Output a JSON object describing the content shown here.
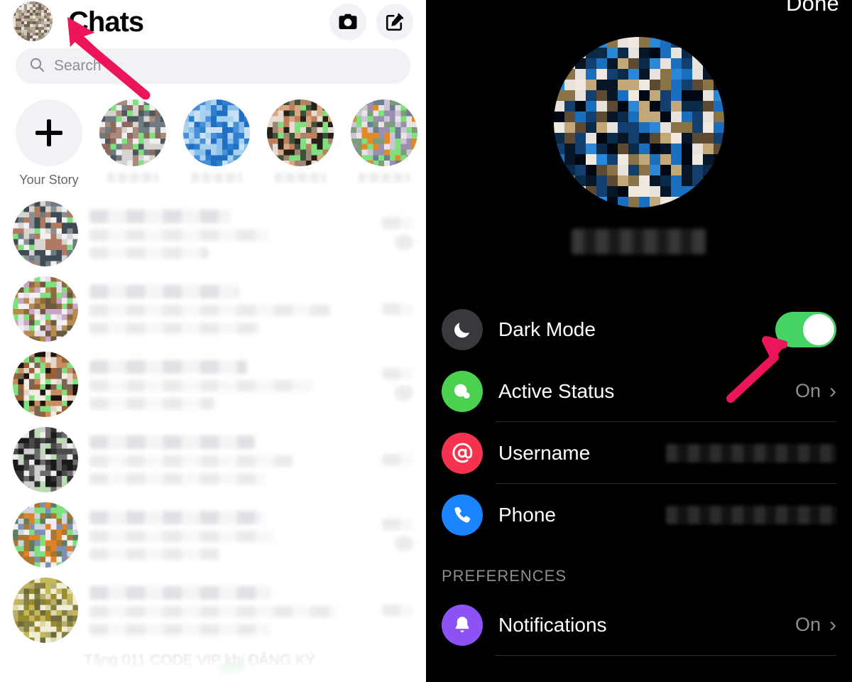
{
  "left": {
    "title": "Chats",
    "avatar_name": "user-avatar",
    "header_actions": [
      {
        "name": "camera-icon",
        "label": "Camera"
      },
      {
        "name": "compose-icon",
        "label": "New message"
      }
    ],
    "search": {
      "placeholder": "Search",
      "value": "",
      "icon": "search-icon"
    },
    "stories": {
      "add_label": "Your Story",
      "add_icon": "plus-icon",
      "items": [
        {
          "name": "story-1",
          "label": ""
        },
        {
          "name": "story-2",
          "label": ""
        },
        {
          "name": "story-3",
          "label": ""
        },
        {
          "name": "story-4",
          "label": ""
        }
      ]
    },
    "chats": [
      {
        "name": "chat-row-1",
        "name_text": "",
        "preview": "",
        "time": "",
        "badge": ""
      },
      {
        "name": "chat-row-2",
        "name_text": "",
        "preview": "",
        "time": "",
        "badge": ""
      },
      {
        "name": "chat-row-3",
        "name_text": "",
        "preview": "",
        "time": "",
        "badge": ""
      },
      {
        "name": "chat-row-4",
        "name_text": "",
        "preview": "",
        "time": "",
        "badge": ""
      },
      {
        "name": "chat-row-5",
        "name_text": "",
        "preview": "",
        "time": "",
        "badge": ""
      },
      {
        "name": "chat-row-6",
        "name_text": "",
        "preview": "",
        "time": "",
        "badge": ""
      }
    ],
    "partial_bottom_text": "Tặng 011 CODE VIP khi ĐĂNG KÝ"
  },
  "right": {
    "done_label": "Done",
    "profile": {
      "photo": "profile-photo",
      "name": ""
    },
    "rows": [
      {
        "name": "dark-mode",
        "label": "Dark Mode",
        "icon": "moon-icon",
        "icon_color": "#39393d",
        "control": "toggle",
        "value": "On",
        "separator": false
      },
      {
        "name": "active-status",
        "label": "Active Status",
        "icon": "chat-bubble-icon",
        "icon_color": "#4ad14f",
        "control": "value-chevron",
        "value": "On",
        "separator": true
      },
      {
        "name": "username",
        "label": "Username",
        "icon": "at-sign-icon",
        "icon_color": "#f5334f",
        "control": "blurred-value",
        "value": "",
        "separator": true
      },
      {
        "name": "phone",
        "label": "Phone",
        "icon": "phone-icon",
        "icon_color": "#1b84ff",
        "control": "blurred-value",
        "value": "",
        "separator": false
      }
    ],
    "preferences_title": "PREFERENCES",
    "preference_rows": [
      {
        "name": "notifications",
        "label": "Notifications",
        "icon": "bell-icon",
        "icon_color": "#8c52f5",
        "control": "value-chevron",
        "value": "On",
        "separator": true
      }
    ]
  },
  "annotations": {
    "arrows": [
      {
        "name": "arrow-to-avatar",
        "color": "#ec1559"
      },
      {
        "name": "arrow-to-dark-mode-toggle",
        "color": "#ec1559"
      }
    ]
  },
  "colors": {
    "accent_green": "#45d464",
    "accent_red": "#f5334f",
    "accent_blue": "#1b84ff",
    "accent_purple": "#8c52f5",
    "arrow_pink": "#ec1559",
    "dark_bg": "#000000",
    "light_bg": "#ffffff",
    "muted_text": "#8d8d93"
  }
}
